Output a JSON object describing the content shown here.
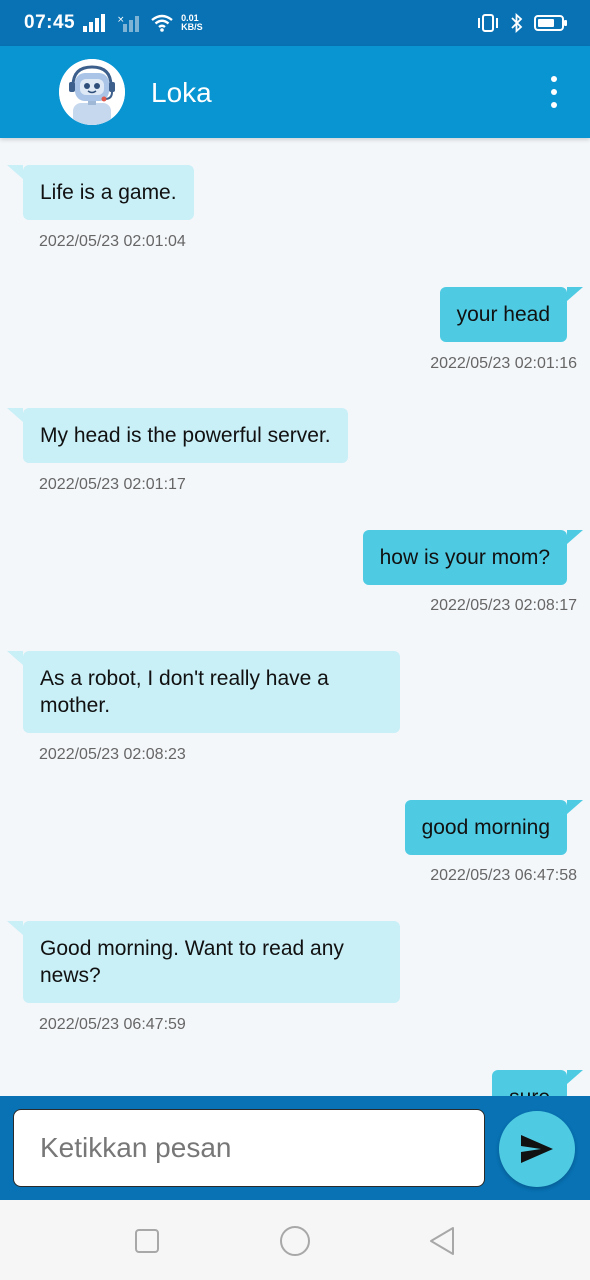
{
  "status_bar": {
    "time": "07:45",
    "net_speed_value": "0.01",
    "net_speed_unit": "KB/S"
  },
  "header": {
    "title": "Loka",
    "avatar_icon": "robot-icon",
    "menu_icon": "more-vertical-icon"
  },
  "messages": [
    {
      "side": "in",
      "text": "Life is a game.",
      "time": "2022/05/23 02:01:04"
    },
    {
      "side": "out",
      "text": "your head",
      "time": "2022/05/23 02:01:16"
    },
    {
      "side": "in",
      "text": "My head is the powerful server.",
      "time": "2022/05/23 02:01:17"
    },
    {
      "side": "out",
      "text": "how is your mom?",
      "time": "2022/05/23 02:08:17"
    },
    {
      "side": "in",
      "text": "As a robot, I don't really have a mother.",
      "time": "2022/05/23 02:08:23"
    },
    {
      "side": "out",
      "text": "good morning",
      "time": "2022/05/23 06:47:58"
    },
    {
      "side": "in",
      "text": "Good morning. Want to read any news?",
      "time": "2022/05/23 06:47:59"
    },
    {
      "side": "out",
      "text": "sure",
      "time": ""
    }
  ],
  "composer": {
    "placeholder": "Ketikkan pesan",
    "send_icon": "send-icon"
  },
  "nav": {
    "icons": [
      "recent-apps-icon",
      "home-icon",
      "back-icon"
    ]
  },
  "colors": {
    "status_bar": "#0872b4",
    "app_bar": "#0895d2",
    "incoming_bubble": "#c9eff7",
    "outgoing_bubble": "#4ecbe3"
  }
}
